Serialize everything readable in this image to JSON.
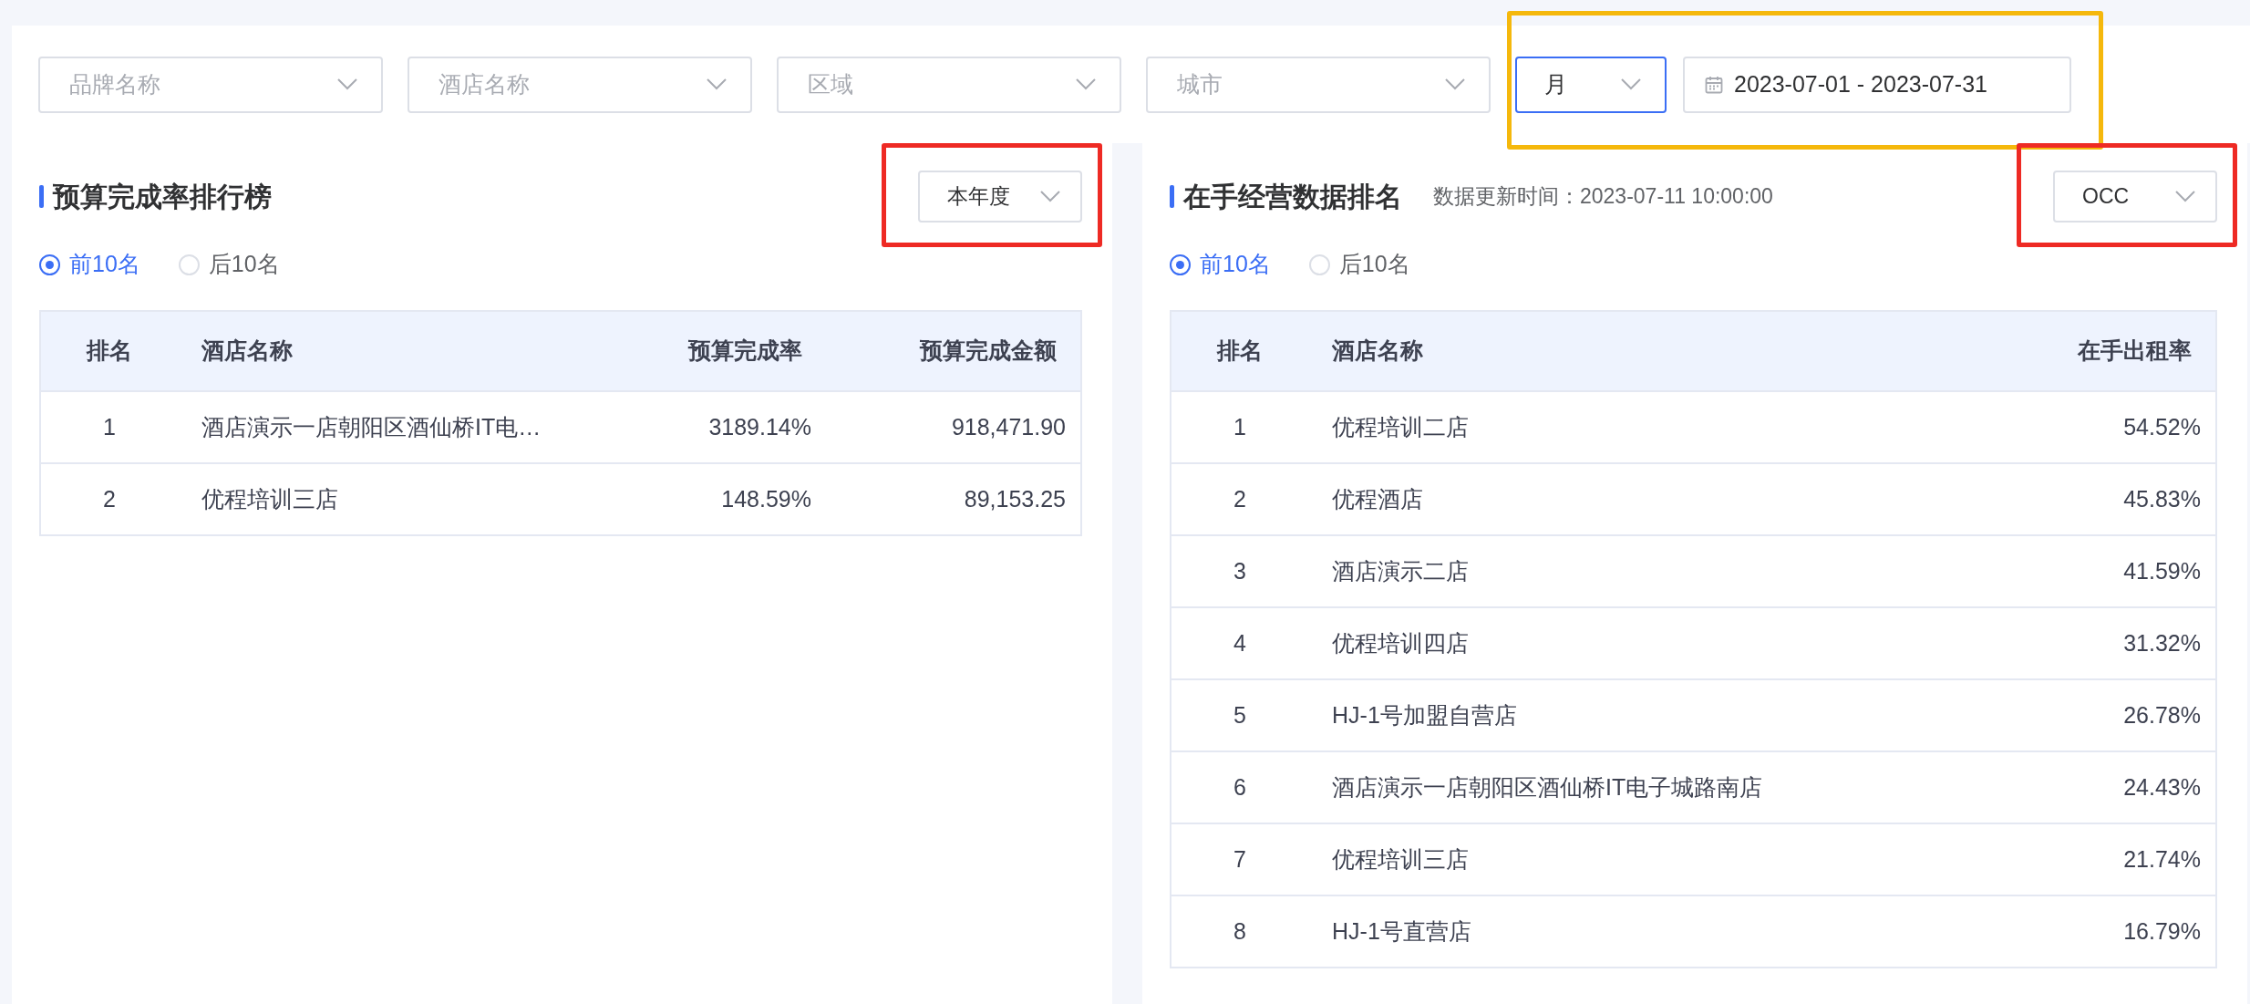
{
  "filters": {
    "selects": [
      {
        "placeholder": "品牌名称"
      },
      {
        "placeholder": "酒店名称"
      },
      {
        "placeholder": "区域"
      },
      {
        "placeholder": "城市"
      }
    ],
    "period": {
      "value": "月"
    },
    "date_range": {
      "value": "2023-07-01 - 2023-07-31"
    },
    "highlight": {
      "color": "#f5b80c"
    }
  },
  "panels": [
    {
      "title": "预算完成率排行榜",
      "dropdown": {
        "value": "本年度"
      },
      "highlight": {
        "color": "#ee2a24"
      },
      "radios": [
        {
          "label": "前10名",
          "selected": true
        },
        {
          "label": "后10名",
          "selected": false
        }
      ],
      "table": {
        "columns": [
          "排名",
          "酒店名称",
          "预算完成率",
          "预算完成金额"
        ],
        "rows": [
          [
            "1",
            "酒店演示一店朝阳区酒仙桥IT电…",
            "3189.14%",
            "918,471.90"
          ],
          [
            "2",
            "优程培训三店",
            "148.59%",
            "89,153.25"
          ]
        ]
      }
    },
    {
      "title": "在手经营数据排名",
      "update_time": "数据更新时间：2023-07-11 10:00:00",
      "dropdown": {
        "value": "OCC"
      },
      "highlight": {
        "color": "#ee2a24"
      },
      "radios": [
        {
          "label": "前10名",
          "selected": true
        },
        {
          "label": "后10名",
          "selected": false
        }
      ],
      "table": {
        "columns": [
          "排名",
          "酒店名称",
          "在手出租率"
        ],
        "rows": [
          [
            "1",
            "优程培训二店",
            "54.52%"
          ],
          [
            "2",
            "优程酒店",
            "45.83%"
          ],
          [
            "3",
            "酒店演示二店",
            "41.59%"
          ],
          [
            "4",
            "优程培训四店",
            "31.32%"
          ],
          [
            "5",
            "HJ-1号加盟自营店",
            "26.78%"
          ],
          [
            "6",
            "酒店演示一店朝阳区酒仙桥IT电子城路南店",
            "24.43%"
          ],
          [
            "7",
            "优程培训三店",
            "21.74%"
          ],
          [
            "8",
            "HJ-1号直营店",
            "16.79%"
          ]
        ]
      }
    }
  ]
}
